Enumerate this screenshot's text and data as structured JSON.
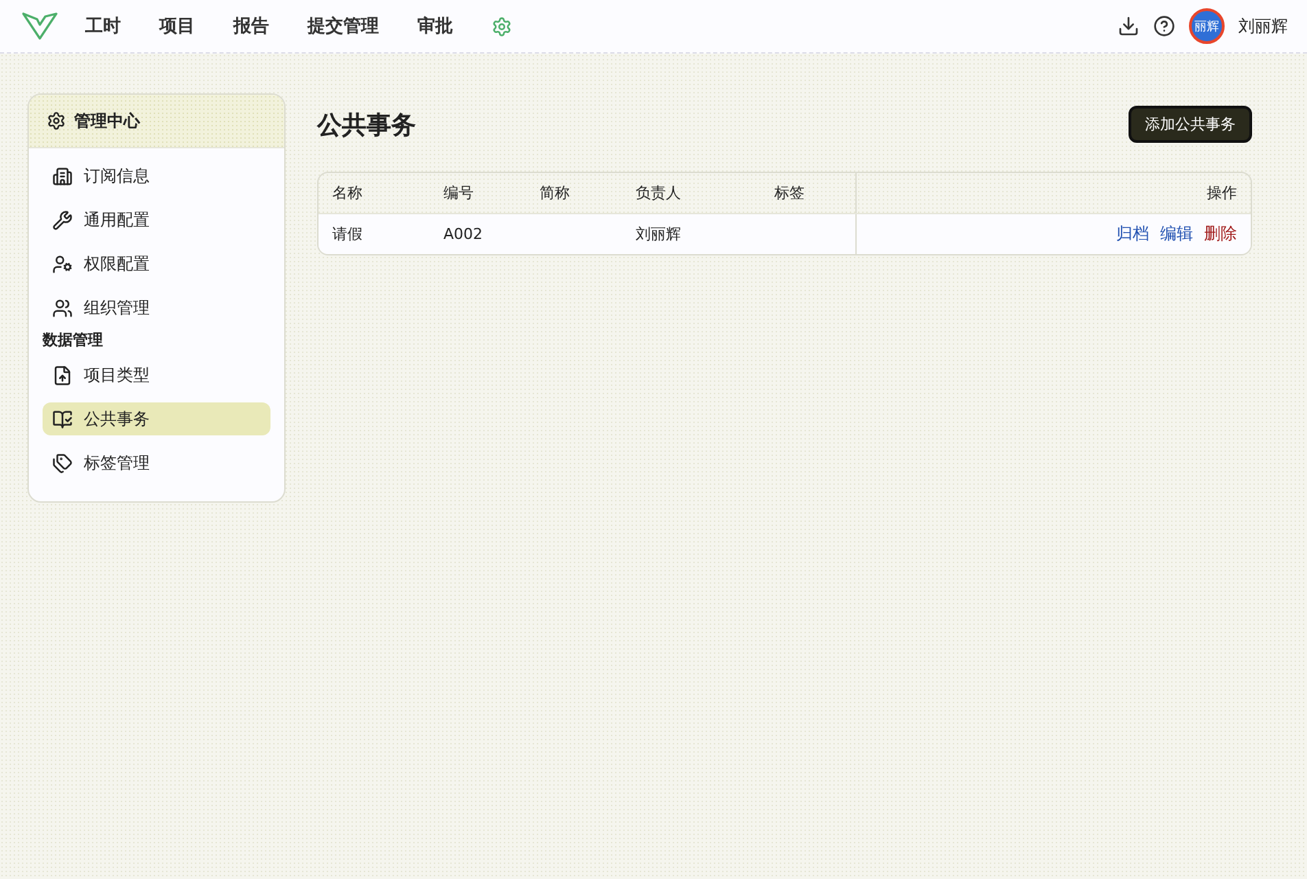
{
  "nav": {
    "items": [
      {
        "label": "工时"
      },
      {
        "label": "项目"
      },
      {
        "label": "报告"
      },
      {
        "label": "提交管理"
      },
      {
        "label": "审批"
      }
    ]
  },
  "user": {
    "avatar_text": "丽辉",
    "name": "刘丽辉"
  },
  "sidebar": {
    "title": "管理中心",
    "items": [
      {
        "kind": "item",
        "label": "订阅信息",
        "selected": false
      },
      {
        "kind": "item",
        "label": "通用配置",
        "selected": false
      },
      {
        "kind": "item",
        "label": "权限配置",
        "selected": false
      },
      {
        "kind": "item",
        "label": "组织管理",
        "selected": false
      },
      {
        "kind": "section",
        "label": "数据管理"
      },
      {
        "kind": "item",
        "label": "项目类型",
        "selected": false
      },
      {
        "kind": "item",
        "label": "公共事务",
        "selected": true
      },
      {
        "kind": "item",
        "label": "标签管理",
        "selected": false
      }
    ]
  },
  "page": {
    "title": "公共事务",
    "add_button": "添加公共事务"
  },
  "table": {
    "columns": [
      "名称",
      "编号",
      "简称",
      "负责人",
      "标签"
    ],
    "action_column": "操作",
    "rows": [
      {
        "cells": [
          "请假",
          "A002",
          "",
          "刘丽辉",
          ""
        ],
        "actions": [
          {
            "label": "归档",
            "kind": "normal"
          },
          {
            "label": "编辑",
            "kind": "normal"
          },
          {
            "label": "删除",
            "kind": "danger"
          }
        ]
      }
    ]
  }
}
